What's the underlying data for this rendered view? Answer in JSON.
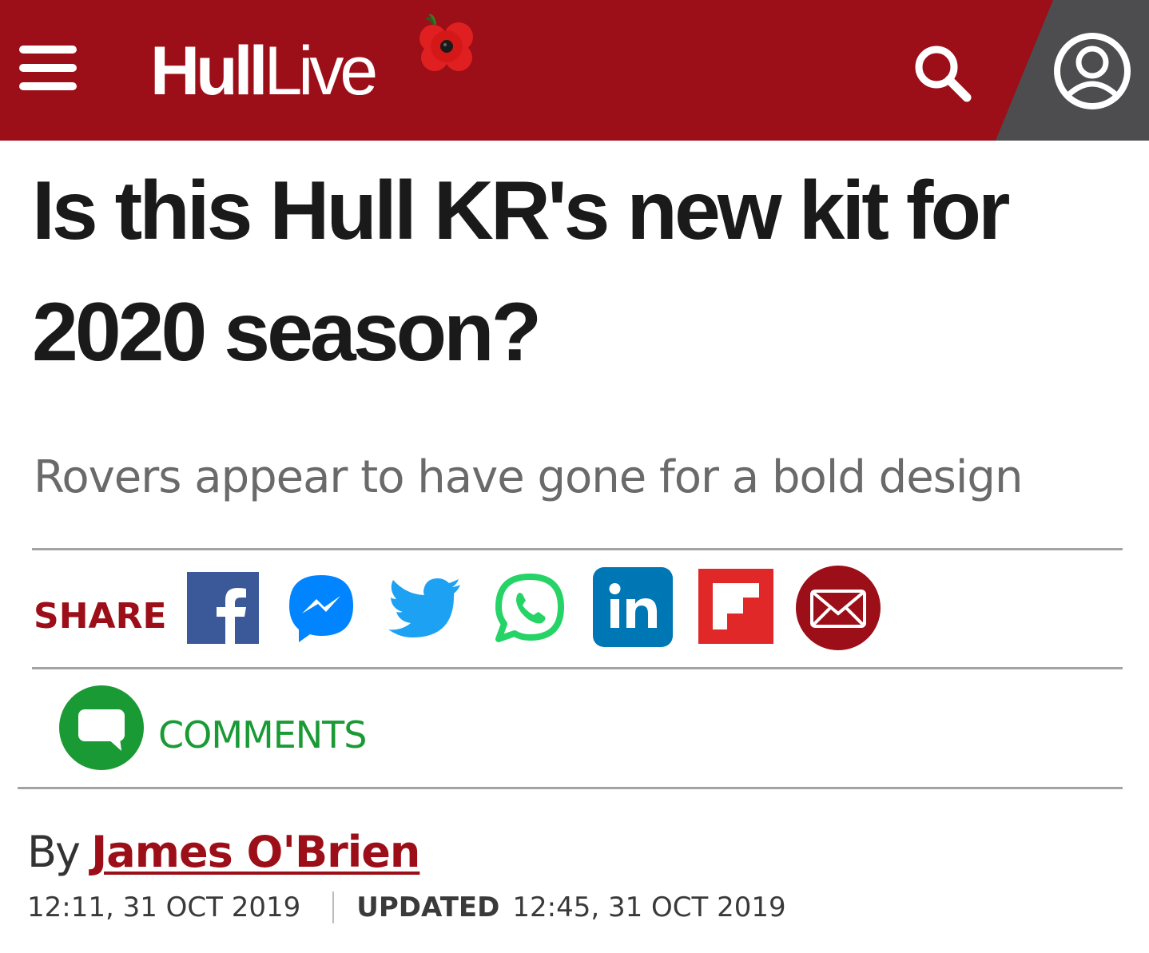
{
  "header": {
    "brand_bold": "Hull",
    "brand_light": "Live",
    "menu_icon": "hamburger-menu-icon",
    "poppy_icon": "poppy-icon",
    "search_icon": "search-icon",
    "account_icon": "user-account-icon",
    "colors": {
      "brand_red": "#9c0e18",
      "account_bg": "#4d4d4f"
    }
  },
  "article": {
    "headline": "Is this Hull KR's new kit for 2020 season?",
    "standfirst": "Rovers appear to have gone for a bold design"
  },
  "share": {
    "label": "SHARE",
    "icons": [
      {
        "name": "facebook-icon",
        "color": "#3b5998"
      },
      {
        "name": "messenger-icon",
        "color": "#0084ff"
      },
      {
        "name": "twitter-icon",
        "color": "#1da1f2"
      },
      {
        "name": "whatsapp-icon",
        "color": "#25d366"
      },
      {
        "name": "linkedin-icon",
        "color": "#0077b5"
      },
      {
        "name": "flipboard-icon",
        "color": "#e12828"
      },
      {
        "name": "email-icon",
        "color": "#9c0e18"
      }
    ]
  },
  "comments": {
    "label": "COMMENTS",
    "icon": "comment-bubble-icon",
    "color": "#1a9a35"
  },
  "byline": {
    "prefix": "By",
    "author": "James O'Brien",
    "published": "12:11, 31 OCT 2019",
    "updated_label": "UPDATED",
    "updated": "12:45, 31 OCT 2019"
  }
}
